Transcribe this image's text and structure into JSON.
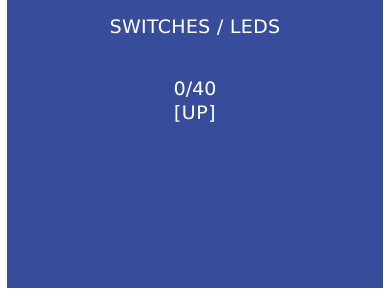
{
  "screen": {
    "title": "SWITCHES / LEDS",
    "counter": "0/40",
    "state": "[UP]",
    "background_color": "#374c9b",
    "text_color": "#ffffff"
  }
}
